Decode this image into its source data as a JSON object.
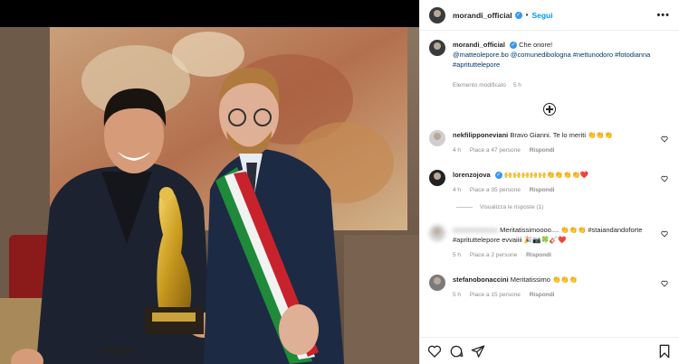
{
  "header": {
    "username": "morandi_official",
    "separator": "•",
    "follow_label": "Segui",
    "more_label": "•••"
  },
  "caption": {
    "username": "morandi_official",
    "text": "Che onore!",
    "tags": "@matteolepore.bo @comunedibologna #nettunodoro #fotodianna #aprituttelepore",
    "edited": "Elemento modificato",
    "time": "5 h"
  },
  "comments": [
    {
      "username": "nekfilipponeviani",
      "text": "Bravo Gianni. Te lo meriti 👏👏👏",
      "time": "4 h",
      "likes": "Piace a 47 persone",
      "reply": "Rispondi"
    },
    {
      "username": "lorenzojova",
      "text": "🙌🙌🙌🙌🙌👏👏👏👏❤️",
      "time": "4 h",
      "likes": "Piace a 35 persone",
      "reply": "Rispondi",
      "view_replies": "Visualizza le risposte (1)"
    },
    {
      "username": "",
      "text": "Meritatissimoooo.... 👏👏👏 #staiandandoforte #aprituttelepore evvaiiii 🎉📷🍀🎸❤️",
      "time": "5 h",
      "likes": "Piace a 2 persone",
      "reply": "Rispondi"
    },
    {
      "username": "stefanobonaccini",
      "text": "Meritatissimo 👏👏👏",
      "time": "5 h",
      "likes": "Piace a 15 persone",
      "reply": "Rispondi"
    }
  ],
  "colors": {
    "accent": "#0095f6",
    "verified": "#3897f0",
    "heart": "#ed4956"
  },
  "icons": [
    "heart-icon",
    "comment-icon",
    "share-icon",
    "bookmark-icon",
    "add-comment-icon",
    "more-icon",
    "verified-icon"
  ]
}
